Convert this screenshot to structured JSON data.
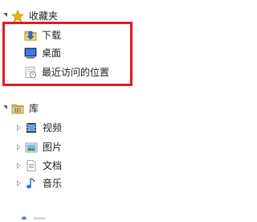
{
  "nav_pane": {
    "favorites": {
      "label": "收藏夹",
      "icon": "star-icon",
      "expanded": true,
      "items": [
        {
          "label": "下载",
          "icon": "downloads-folder-icon"
        },
        {
          "label": "桌面",
          "icon": "desktop-icon"
        },
        {
          "label": "最近访问的位置",
          "icon": "recent-places-icon"
        }
      ]
    },
    "libraries": {
      "label": "库",
      "icon": "library-folder-icon",
      "expanded": true,
      "items": [
        {
          "label": "视频",
          "icon": "video-library-icon"
        },
        {
          "label": "图片",
          "icon": "pictures-library-icon"
        },
        {
          "label": "文档",
          "icon": "documents-library-icon"
        },
        {
          "label": "音乐",
          "icon": "music-library-icon"
        }
      ]
    }
  },
  "colors": {
    "highlight_border": "#e01b22",
    "star": "#f2b400"
  }
}
